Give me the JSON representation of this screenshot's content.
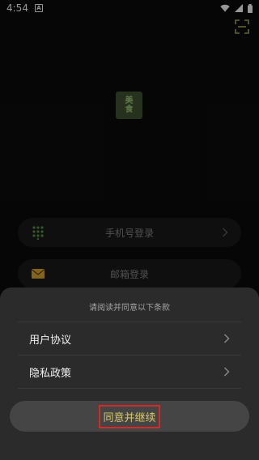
{
  "status_bar": {
    "time": "4:54",
    "notification_badge": "A"
  },
  "logo": {
    "line1": "美",
    "line2": "食"
  },
  "login_options": [
    {
      "label": "手机号登录",
      "icon": "keypad-icon"
    },
    {
      "label": "邮箱登录",
      "icon": "mail-icon"
    }
  ],
  "terms_sheet": {
    "title": "请阅读并同意以下条款",
    "items": [
      {
        "label": "用户协议"
      },
      {
        "label": "隐私政策"
      }
    ],
    "agree_button": "同意并继续"
  },
  "colors": {
    "background": "#0a0a0a",
    "sheet": "#2b2b2b",
    "button": "#454545",
    "button_text": "#d9c86a",
    "highlight_box": "#d42a2a",
    "logo_bg": "#3c4e2e"
  }
}
